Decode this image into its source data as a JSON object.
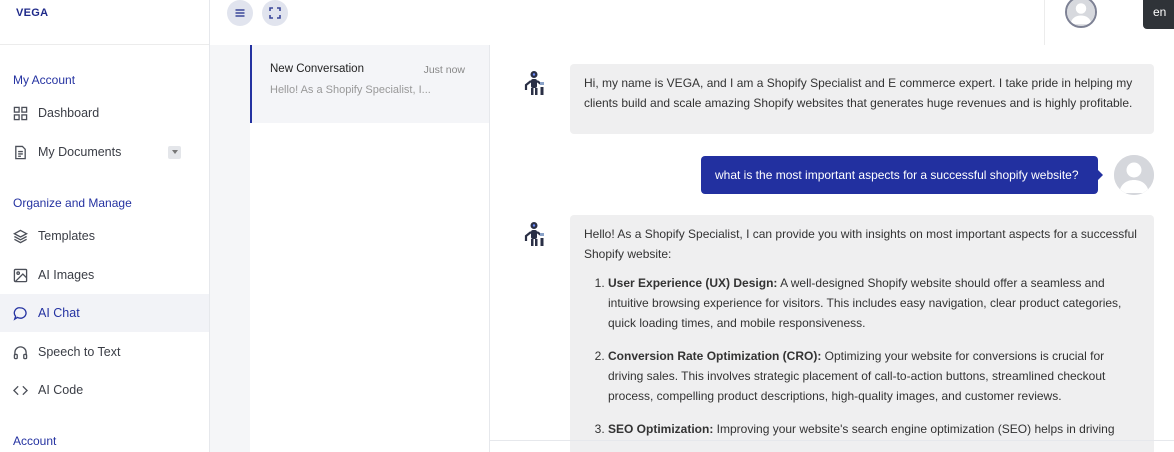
{
  "brand": "VEGA",
  "sidebar": {
    "section_my_account": "My Account",
    "dashboard": "Dashboard",
    "my_documents": "My Documents",
    "section_organize": "Organize and Manage",
    "templates": "Templates",
    "ai_images": "AI Images",
    "ai_chat": "AI Chat",
    "speech_to_text": "Speech to Text",
    "ai_code": "AI Code",
    "section_account": "Account"
  },
  "topbar": {
    "language": "en"
  },
  "conversation": {
    "title": "New Conversation",
    "time": "Just now",
    "preview": "Hello! As a Shopify Specialist, I..."
  },
  "chat": {
    "bot_intro": "Hi, my name is VEGA, and I am a Shopify Specialist and E commerce expert. I take pride in helping my clients build and scale amazing Shopify websites that generates huge revenues and is highly profitable.",
    "user_question": "what is the most important aspects for a successful shopify website?",
    "bot_reply_intro": "Hello! As a Shopify Specialist, I can provide you with insights on most important aspects for a successful Shopify website:",
    "points": [
      {
        "title": "User Experience (UX) Design:",
        "text": " A well-designed Shopify website should offer a seamless and intuitive browsing experience for visitors. This includes easy navigation, clear product categories, quick loading times, and mobile responsiveness."
      },
      {
        "title": "Conversion Rate Optimization (CRO):",
        "text": " Optimizing your website for conversions is crucial for driving sales. This involves strategic placement of call-to-action buttons, streamlined checkout process, compelling product descriptions, high-quality images, and customer reviews."
      },
      {
        "title": "SEO Optimization:",
        "text": " Improving your website's search engine optimization (SEO) helps in driving"
      }
    ]
  },
  "colors": {
    "accent": "#2230a0",
    "bot_bubble": "#efeff0",
    "sidebar_bg": "#ffffff",
    "page_bg": "#f5f6f8"
  }
}
